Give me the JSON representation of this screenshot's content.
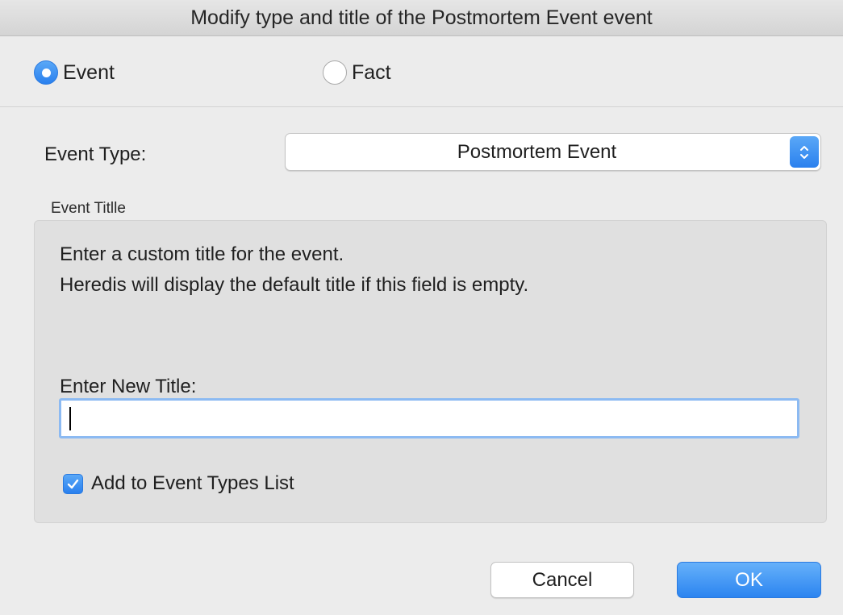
{
  "window": {
    "title": "Modify type and title of the Postmortem Event event"
  },
  "mode": {
    "options": [
      {
        "label": "Event",
        "selected": true
      },
      {
        "label": "Fact",
        "selected": false
      }
    ]
  },
  "event_type": {
    "label": "Event Type:",
    "selected_value": "Postmortem Event"
  },
  "event_title_group": {
    "heading": "Event Titlle",
    "description_line1": "Enter a custom title for the event.",
    "description_line2": "Heredis will display the default title if this field is empty.",
    "input_label": "Enter New Title:",
    "input_value": "",
    "add_to_list": {
      "label": "Add to Event Types List",
      "checked": true
    }
  },
  "buttons": {
    "cancel": "Cancel",
    "ok": "OK"
  },
  "colors": {
    "accent": "#2a80ee",
    "focus_ring": "#8cbaf2",
    "window_bg": "#ececec",
    "group_bg": "#e0e0e0"
  },
  "icons": {
    "radio_selected": "radio-selected-icon",
    "radio_unselected": "radio-unselected-icon",
    "popup_stepper": "chevron-up-down-icon",
    "checkbox": "checkmark-icon"
  }
}
